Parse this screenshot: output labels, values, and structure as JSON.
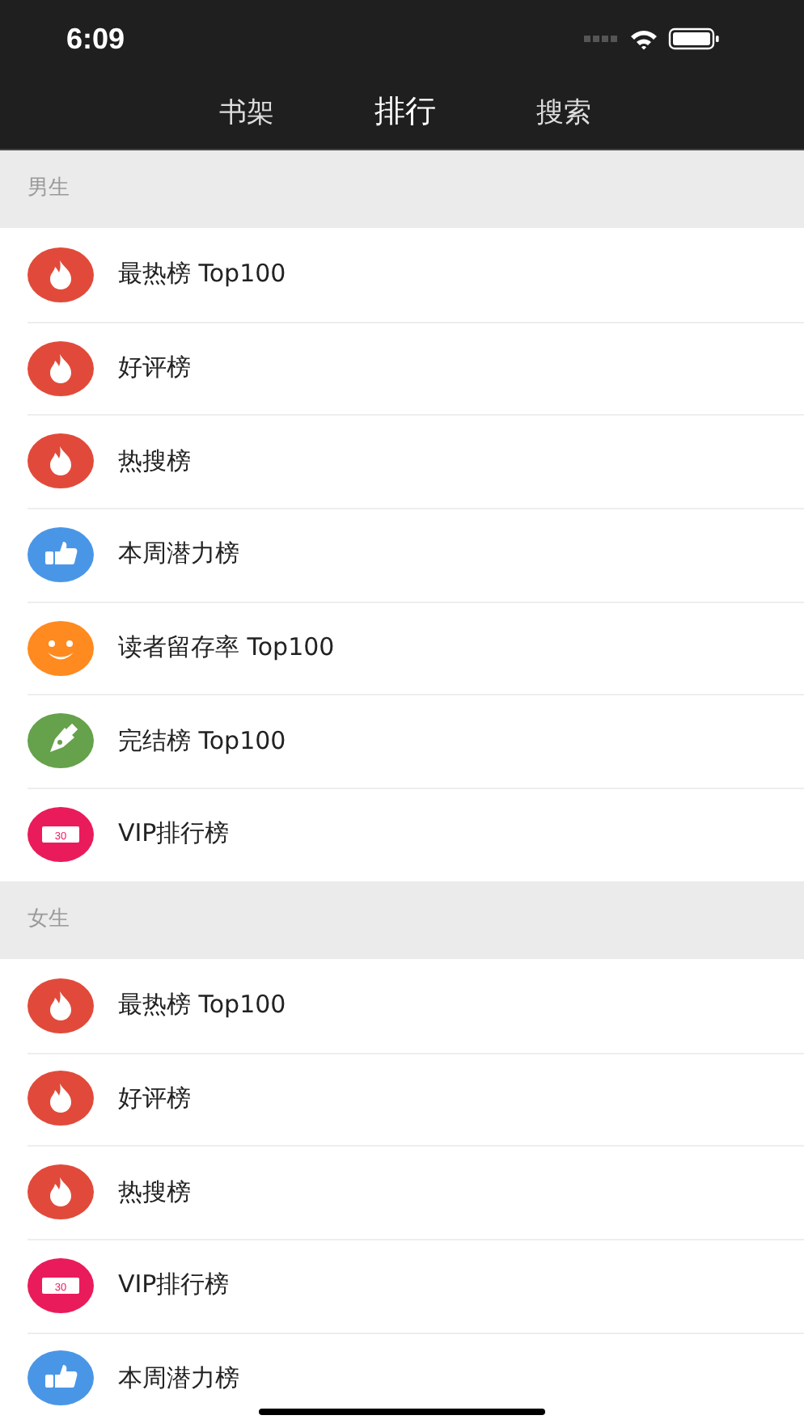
{
  "status_bar": {
    "time": "6:09"
  },
  "tabs": [
    {
      "label": "书架",
      "selected": false
    },
    {
      "label": "排行",
      "selected": true
    },
    {
      "label": "搜索",
      "selected": false
    }
  ],
  "sections": [
    {
      "title": "男生",
      "items": [
        {
          "label": "最热榜 Top100",
          "kind": "fire"
        },
        {
          "label": "好评榜",
          "kind": "fire"
        },
        {
          "label": "热搜榜",
          "kind": "fire"
        },
        {
          "label": "本周潜力榜",
          "kind": "thumb"
        },
        {
          "label": "读者留存率 Top100",
          "kind": "smile"
        },
        {
          "label": "完结榜 Top100",
          "kind": "pen"
        },
        {
          "label": "VIP排行榜",
          "kind": "ticket",
          "icon_text": "30"
        }
      ]
    },
    {
      "title": "女生",
      "items": [
        {
          "label": "最热榜 Top100",
          "kind": "fire"
        },
        {
          "label": "好评榜",
          "kind": "fire"
        },
        {
          "label": "热搜榜",
          "kind": "fire"
        },
        {
          "label": "VIP排行榜",
          "kind": "ticket",
          "icon_text": "30"
        },
        {
          "label": "本周潜力榜",
          "kind": "thumb"
        }
      ]
    }
  ]
}
